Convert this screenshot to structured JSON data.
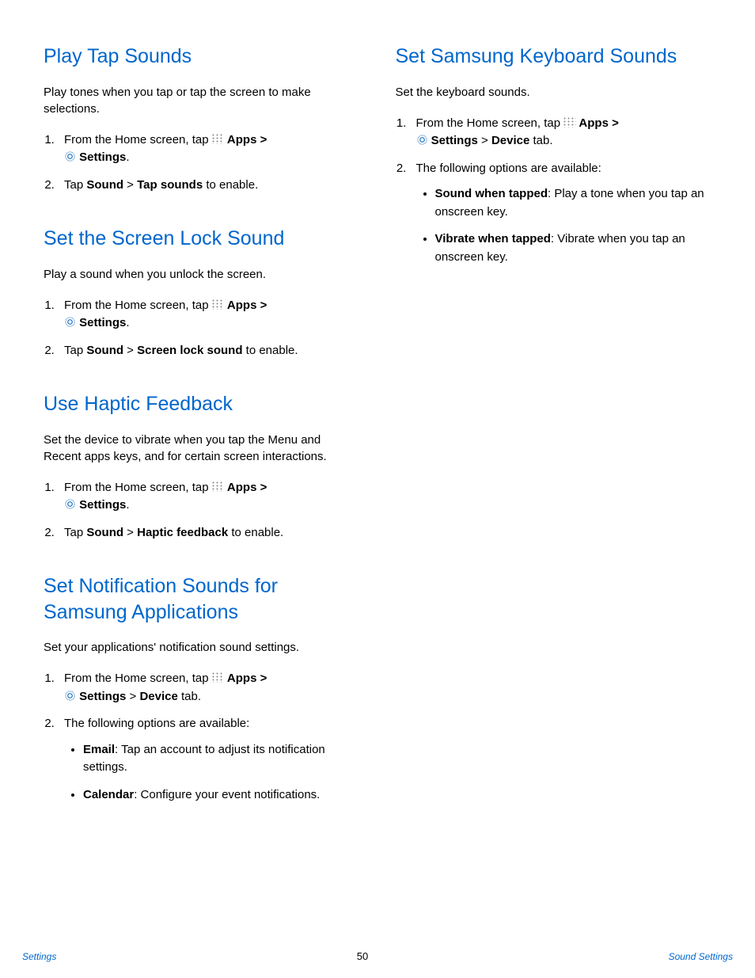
{
  "left": {
    "section1": {
      "heading": "Play Tap Sounds",
      "intro": "Play tones when you tap or tap the screen to make selections.",
      "step1_a": "From the Home screen, tap ",
      "apps": "Apps",
      "gt": " >",
      "settings": "Settings",
      "step2_a": "Tap ",
      "step2_b": "Sound",
      "step2_c": " > ",
      "step2_d": "Tap sounds",
      "step2_e": " to enable."
    },
    "section2": {
      "heading": "Set the Screen Lock Sound",
      "intro": "Play a sound when you unlock the screen.",
      "step1_a": "From the Home screen, tap ",
      "apps": "Apps",
      "gt": " >",
      "settings": "Settings",
      "step2_a": "Tap ",
      "step2_b": "Sound",
      "step2_c": " > ",
      "step2_d": "Screen lock sound",
      "step2_e": " to enable."
    },
    "section3": {
      "heading": "Use Haptic Feedback",
      "intro": "Set the device to vibrate when you tap the Menu and Recent apps keys, and for certain screen interactions.",
      "step1_a": "From the Home screen, tap ",
      "apps": "Apps",
      "gt": " >",
      "settings": "Settings",
      "step2_a": "Tap ",
      "step2_b": "Sound",
      "step2_c": " > ",
      "step2_d": "Haptic feedback",
      "step2_e": " to enable."
    },
    "section4": {
      "heading": "Set Notification Sounds for Samsung Applications",
      "intro": "Set your applications' notification sound settings.",
      "step1_a": "From the Home screen, tap ",
      "apps": "Apps",
      "gt": " >",
      "settings": "Settings",
      "device_gt": " > ",
      "device": "Device",
      "device_tab": " tab.",
      "step2": "The following options are available:",
      "bullet1_a": "Email",
      "bullet1_b": ": Tap an account to adjust its notification settings.",
      "bullet2_a": "Calendar",
      "bullet2_b": ": Configure your event notifications."
    }
  },
  "right": {
    "section1": {
      "heading": "Set Samsung Keyboard Sounds",
      "intro": "Set the keyboard sounds.",
      "step1_a": "From the Home screen, tap ",
      "apps": "Apps",
      "gt": " >",
      "settings": "Settings",
      "device_gt": " > ",
      "device": "Device",
      "device_tab": " tab.",
      "step2": "The following options are available:",
      "bullet1_a": "Sound when tapped",
      "bullet1_b": ": Play a tone when you tap an onscreen key.",
      "bullet2_a": "Vibrate when tapped",
      "bullet2_b": ": Vibrate when you tap an onscreen key."
    }
  },
  "footer": {
    "left": "Settings",
    "page": "50",
    "right": "Sound Settings"
  },
  "common": {
    "period": "."
  }
}
